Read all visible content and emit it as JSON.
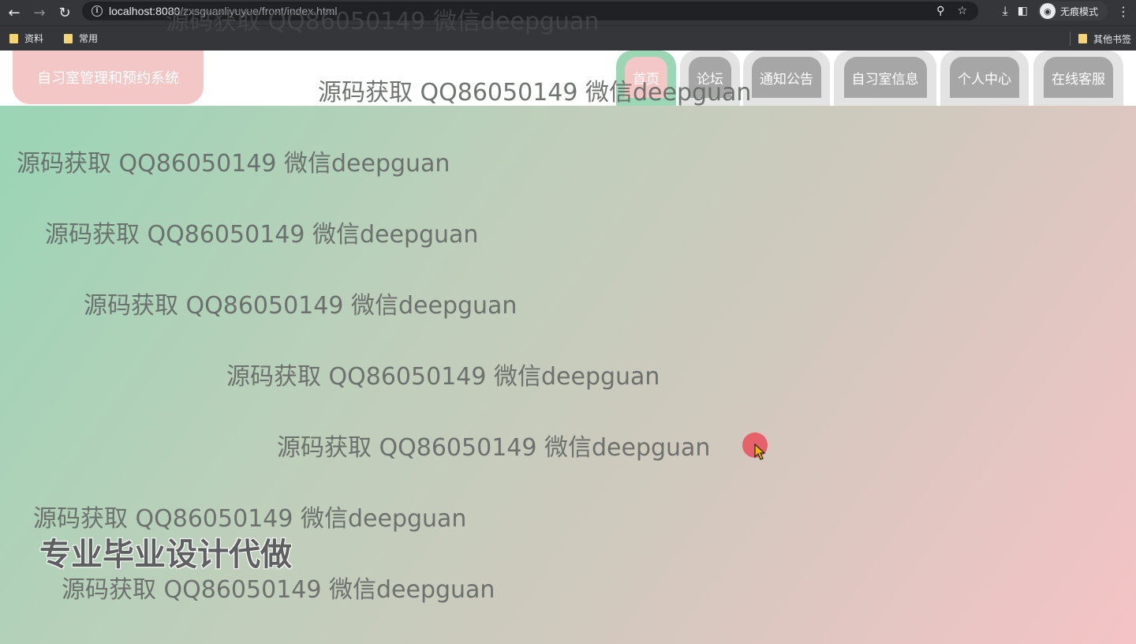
{
  "browser": {
    "url_host": "localhost:8080",
    "url_path": "/zxsguanliyuyue/front/index.html",
    "incognito_label": "无痕模式",
    "bookmarks": [
      {
        "label": "资料"
      },
      {
        "label": "常用"
      }
    ],
    "other_bookmarks": "其他书签"
  },
  "site": {
    "title": "自习室管理和预约系统",
    "nav": [
      {
        "label": "首页",
        "active": true
      },
      {
        "label": "论坛",
        "active": false
      },
      {
        "label": "通知公告",
        "active": false
      },
      {
        "label": "自习室信息",
        "active": false
      },
      {
        "label": "个人中心",
        "active": false
      },
      {
        "label": "在线客服",
        "active": false
      }
    ]
  },
  "watermarks": [
    "源码获取 QQ86050149 微信deepguan",
    "源码获取 QQ86050149 微信deepguan",
    "源码获取 QQ86050149 微信deepguan",
    "源码获取 QQ86050149 微信deepguan",
    "源码获取 QQ86050149 微信deepguan",
    "源码获取 QQ86050149 微信deepguan",
    "源码获取 QQ86050149 微信deepguan",
    "源码获取 QQ86050149 微信deepguan",
    "源码获取 QQ86050149 微信deepguan"
  ],
  "promo": "专业毕业设计代做",
  "colors": {
    "accent_green": "#9bd7b5",
    "accent_pink": "#f4c7c7",
    "nav_gray": "#a6a6a6"
  }
}
